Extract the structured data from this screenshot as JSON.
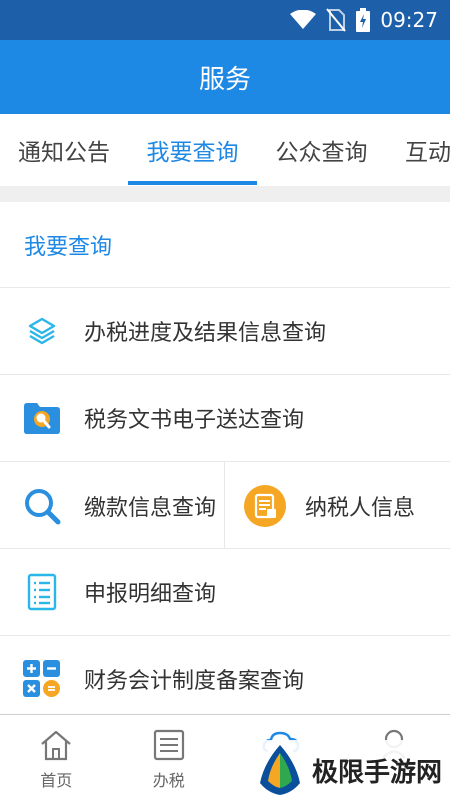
{
  "status": {
    "time": "09:27"
  },
  "appbar": {
    "title": "服务"
  },
  "tabs": [
    {
      "label": "通知公告"
    },
    {
      "label": "我要查询"
    },
    {
      "label": "公众查询"
    },
    {
      "label": "互动"
    }
  ],
  "section": {
    "title": "我要查询"
  },
  "items": {
    "progress": "办税进度及结果信息查询",
    "documents": "税务文书电子送达查询",
    "payment": "缴款信息查询",
    "taxpayer": "纳税人信息",
    "declaration": "申报明细查询",
    "accounting": "财务会计制度备案查询"
  },
  "bottom_nav": [
    {
      "label": "首页"
    },
    {
      "label": "办税"
    },
    {
      "label": ""
    },
    {
      "label": ""
    }
  ],
  "watermark": {
    "text": "极限手游网"
  },
  "colors": {
    "primary": "#1e88e5",
    "status": "#1d5fa8",
    "orange": "#f5a623"
  }
}
